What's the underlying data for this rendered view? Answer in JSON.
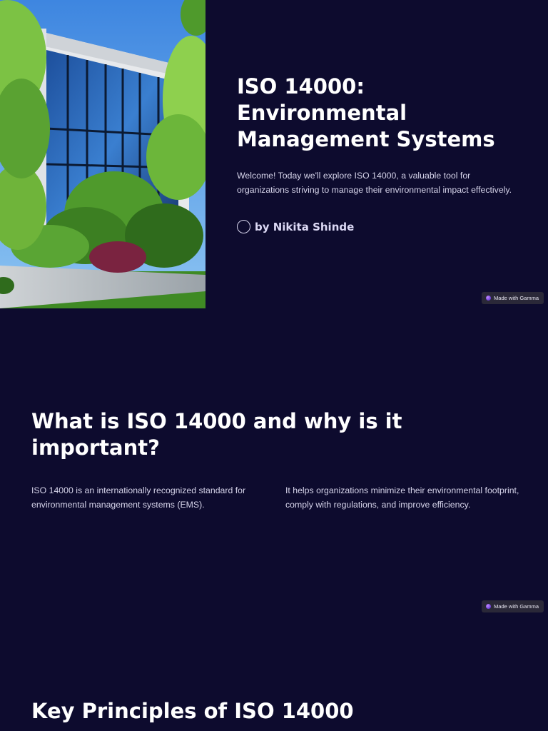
{
  "slides": [
    {
      "title": "ISO 14000: Environmental Management Systems",
      "intro": "Welcome! Today we'll explore ISO 14000, a valuable tool for organizations striving to manage their environmental impact effectively.",
      "author": "by Nikita Shinde",
      "badge": "Made with Gamma"
    },
    {
      "title": "What is ISO 14000 and why is it important?",
      "columns": [
        "ISO 14000 is an internationally recognized standard for environmental management systems (EMS).",
        "It helps organizations minimize their environmental footprint, comply with regulations, and improve efficiency."
      ],
      "badge": "Made with Gamma"
    },
    {
      "title": "Key Principles of ISO 14000"
    }
  ],
  "colors": {
    "background": "#0d0b2e",
    "heading": "#ffffff",
    "body_text": "#d6d4ea",
    "author_text": "#dcd9f5",
    "badge_bg": "#2a2838"
  },
  "icons": {
    "author_avatar": "circle-outline",
    "badge_logo": "gamma-logo-icon"
  }
}
